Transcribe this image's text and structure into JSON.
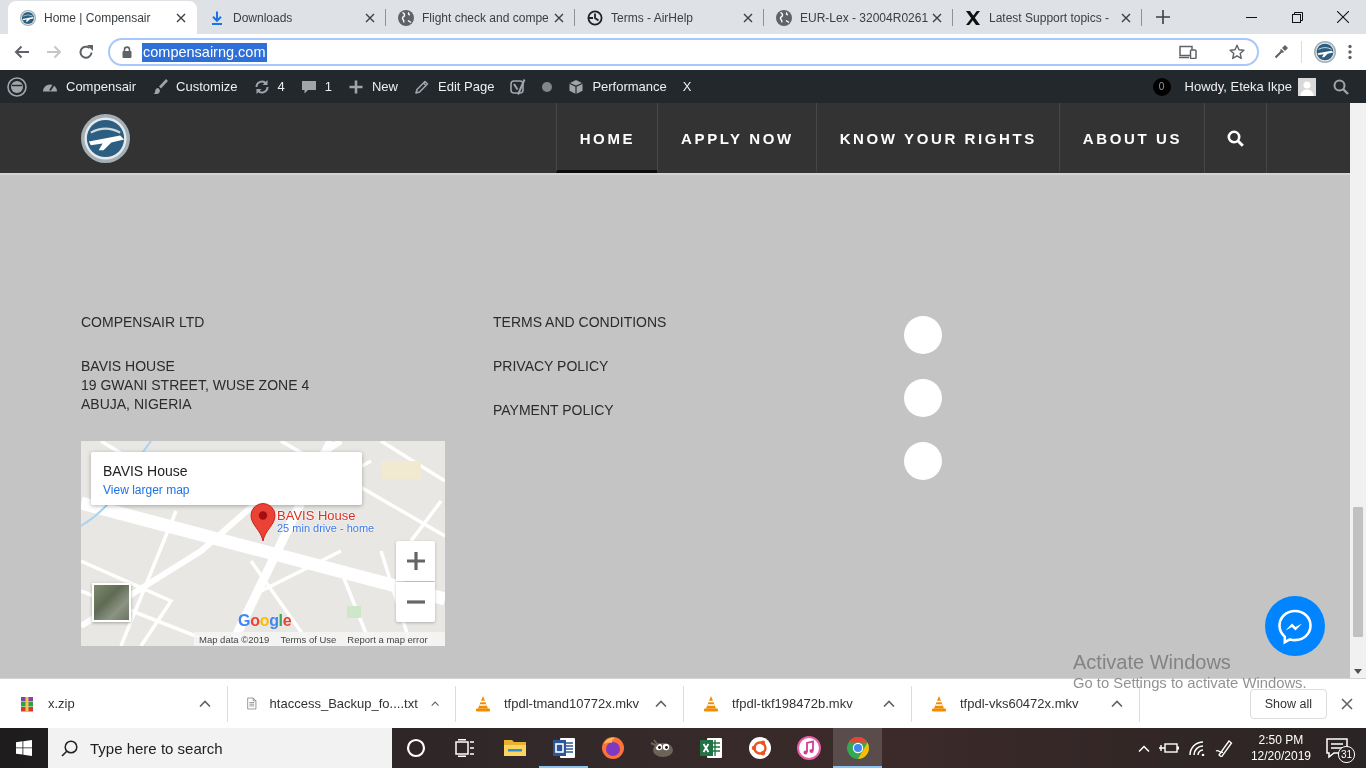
{
  "tabs": [
    {
      "title": "Home | Compensair",
      "kind": "site",
      "selected": true
    },
    {
      "title": "Downloads",
      "kind": "download",
      "selected": false
    },
    {
      "title": "Flight check and compe",
      "kind": "globe",
      "selected": false
    },
    {
      "title": "Terms - AirHelp",
      "kind": "clock",
      "selected": false
    },
    {
      "title": "EUR-Lex - 32004R0261",
      "kind": "globe",
      "selected": false
    },
    {
      "title": "Latest Support topics -",
      "kind": "x-logo",
      "selected": false
    }
  ],
  "toolbar": {
    "nav": [
      {
        "kind": "back",
        "disabled": false
      },
      {
        "kind": "forward",
        "disabled": true
      },
      {
        "kind": "reload",
        "disabled": false
      }
    ],
    "url": "compensairng.com",
    "url_highlighted": true
  },
  "admin_bar": {
    "items": [
      {
        "kind": "wordpress"
      },
      {
        "kind": "dashboard",
        "label": "Compensair"
      },
      {
        "kind": "customize",
        "label": "Customize"
      },
      {
        "kind": "updates",
        "label": "4"
      },
      {
        "kind": "comments",
        "label": "1"
      },
      {
        "kind": "new",
        "label": "New"
      },
      {
        "kind": "edit",
        "label": "Edit Page"
      },
      {
        "kind": "seo"
      },
      {
        "kind": "status"
      },
      {
        "kind": "performance",
        "label": "Performance"
      },
      {
        "kind": "text",
        "label": "X"
      }
    ],
    "notification_count": "0",
    "greeting": "Howdy, Eteka Ikpe"
  },
  "site_header": {
    "nav": [
      {
        "label": "HOME",
        "selected": true
      },
      {
        "label": "APPLY NOW",
        "selected": false
      },
      {
        "label": "KNOW YOUR RIGHTS",
        "selected": false
      },
      {
        "label": "ABOUT US",
        "selected": false
      }
    ]
  },
  "footer": {
    "company": "COMPENSAIR LTD",
    "address_lines": [
      "BAVIS HOUSE",
      "19 GWANI STREET, WUSE ZONE 4",
      "ABUJA, NIGERIA"
    ],
    "map": {
      "place": "BAVIS House",
      "link": "View larger map",
      "marker_title": "BAVIS House",
      "marker_subtitle": "25 min drive - home",
      "logo": "Google",
      "attribution": [
        "Map data ©2019",
        "Terms of Use",
        "Report a map error"
      ]
    },
    "links": [
      "TERMS AND CONDITIONS",
      "PRIVACY POLICY",
      "PAYMENT POLICY"
    ],
    "social_buttons": [
      {
        "kind": "blank"
      },
      {
        "kind": "blank"
      },
      {
        "kind": "blank"
      }
    ]
  },
  "downloads": {
    "items": [
      {
        "name": "x.zip",
        "kind": "archive"
      },
      {
        "name": "htaccess_Backup_fo....txt",
        "kind": "text"
      },
      {
        "name": "tfpdl-tmand10772x.mkv",
        "kind": "video"
      },
      {
        "name": "tfpdl-tkf198472b.mkv",
        "kind": "video"
      },
      {
        "name": "tfpdl-vks60472x.mkv",
        "kind": "video"
      }
    ],
    "show_all": "Show all"
  },
  "taskbar": {
    "search_placeholder": "Type here to search",
    "apps": [
      {
        "kind": "explorer",
        "running": false,
        "selected": false
      },
      {
        "kind": "word",
        "running": true,
        "selected": false
      },
      {
        "kind": "firefox",
        "running": false,
        "selected": false
      },
      {
        "kind": "gimp",
        "running": false,
        "selected": false
      },
      {
        "kind": "excel",
        "running": false,
        "selected": false
      },
      {
        "kind": "ubuntu",
        "running": false,
        "selected": false
      },
      {
        "kind": "itunes",
        "running": false,
        "selected": false
      },
      {
        "kind": "chrome",
        "running": true,
        "selected": true
      }
    ],
    "time": "2:50 PM",
    "date": "12/20/2019",
    "notifications": "31"
  },
  "activation_notice": {
    "title": "Activate Windows",
    "text": "Go to Settings to activate Windows."
  }
}
